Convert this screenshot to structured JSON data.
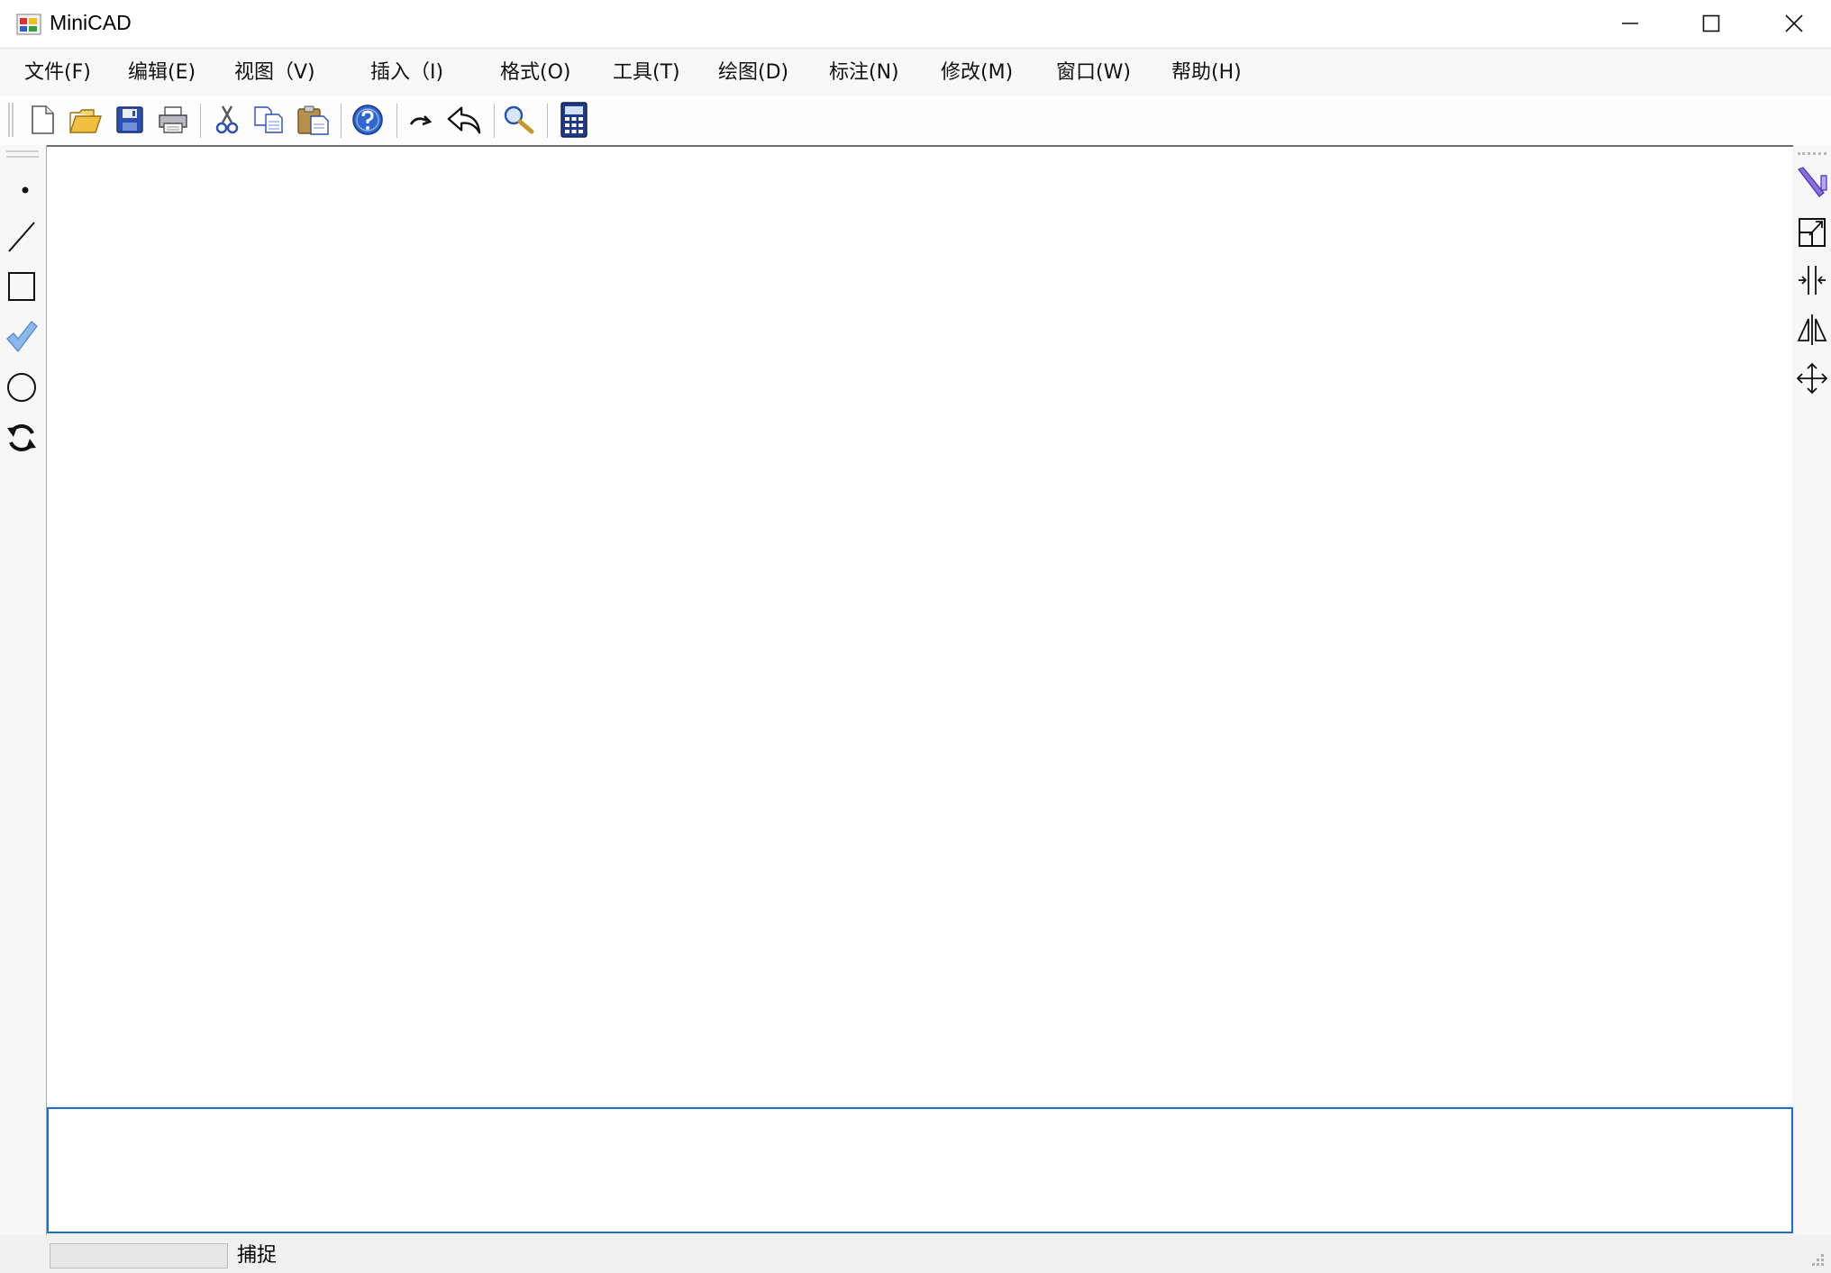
{
  "window": {
    "title": "MiniCAD",
    "controls": [
      "minimize",
      "maximize",
      "close"
    ]
  },
  "menu": [
    {
      "label": "文件(F)"
    },
    {
      "label": "编辑(E)"
    },
    {
      "label": "视图（V)"
    },
    {
      "label": "插入（I)"
    },
    {
      "label": "格式(O)"
    },
    {
      "label": "工具(T)"
    },
    {
      "label": "绘图(D)"
    },
    {
      "label": "标注(N)"
    },
    {
      "label": "修改(M)"
    },
    {
      "label": "窗口(W)"
    },
    {
      "label": "帮助(H)"
    }
  ],
  "toolbar": {
    "buttons": [
      "new-file-icon",
      "open-folder-icon",
      "save-disk-icon",
      "print-icon",
      "cut-scissors-icon",
      "copy-icon",
      "paste-icon",
      "help-question-icon",
      "redo-arrow-icon",
      "undo-arrow-icon",
      "zoom-magnifier-icon",
      "calculator-icon"
    ]
  },
  "draw_tools": [
    "point-icon",
    "line-icon",
    "rectangle-icon",
    "polyline-check-icon",
    "circle-icon",
    "arc-rotate-icon"
  ],
  "modify_tools": [
    "pencil-icon",
    "scale-icon",
    "trim-icon",
    "mirror-icon",
    "move-icon"
  ],
  "command": {
    "value": ""
  },
  "status": {
    "progress": 0,
    "snap_label": "捕捉"
  },
  "colors": {
    "accent": "#1e6fc8",
    "menubar": "#f8f8f8",
    "canvas": "#ffffff"
  }
}
